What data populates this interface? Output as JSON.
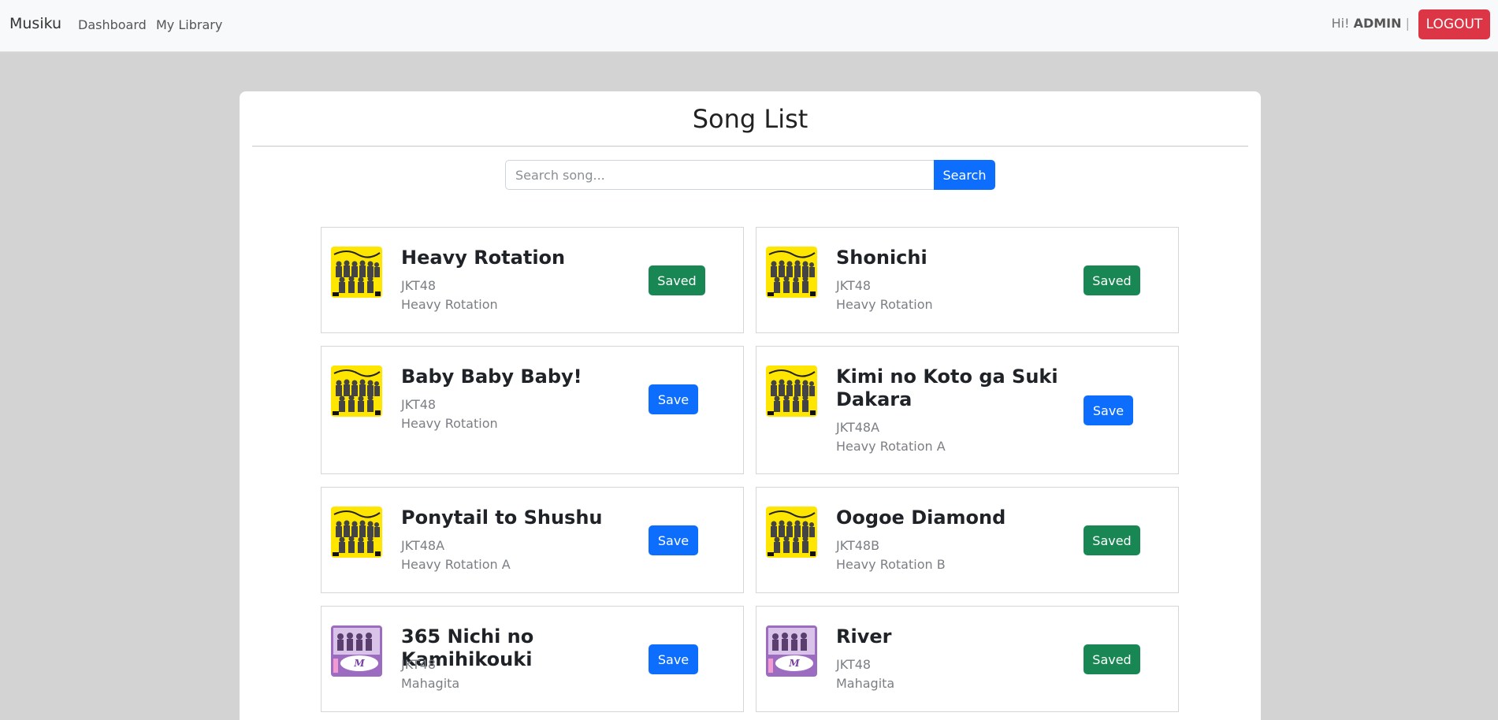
{
  "navbar": {
    "brand": "Musiku",
    "links": [
      "Dashboard",
      "My Library"
    ],
    "greeting_prefix": "Hi!",
    "username": "ADMIN",
    "separator": "|",
    "logout_label": "LOGOUT"
  },
  "page": {
    "title": "Song List",
    "search_placeholder": "Search song...",
    "search_button": "Search"
  },
  "songs": [
    {
      "title": "Heavy Rotation",
      "artist": "JKT48",
      "album": "Heavy Rotation",
      "button": "Saved",
      "cover": "heavy-rotation"
    },
    {
      "title": "Shonichi",
      "artist": "JKT48",
      "album": "Heavy Rotation",
      "button": "Saved",
      "cover": "heavy-rotation"
    },
    {
      "title": "Baby Baby Baby!",
      "artist": "JKT48",
      "album": "Heavy Rotation",
      "button": "Save",
      "cover": "heavy-rotation"
    },
    {
      "title": "Kimi no Koto ga Suki Dakara",
      "artist": "JKT48A",
      "album": "Heavy Rotation A",
      "button": "Save",
      "cover": "heavy-rotation"
    },
    {
      "title": "Ponytail to Shushu",
      "artist": "JKT48A",
      "album": "Heavy Rotation A",
      "button": "Save",
      "cover": "heavy-rotation"
    },
    {
      "title": "Oogoe Diamond",
      "artist": "JKT48B",
      "album": "Heavy Rotation B",
      "button": "Saved",
      "cover": "heavy-rotation"
    },
    {
      "title": "365 Nichi no Kamihikouki",
      "artist": "JKT48",
      "album": "Mahagita",
      "button": "Save",
      "cover": "mahagita"
    },
    {
      "title": "River",
      "artist": "JKT48",
      "album": "Mahagita",
      "button": "Saved",
      "cover": "mahagita"
    }
  ],
  "colors": {
    "saved": "#198754",
    "save": "#0d6efd",
    "logout": "#dc3545",
    "cover_heavy_rotation": "#ffe600",
    "cover_mahagita": "#9b6cc0"
  }
}
